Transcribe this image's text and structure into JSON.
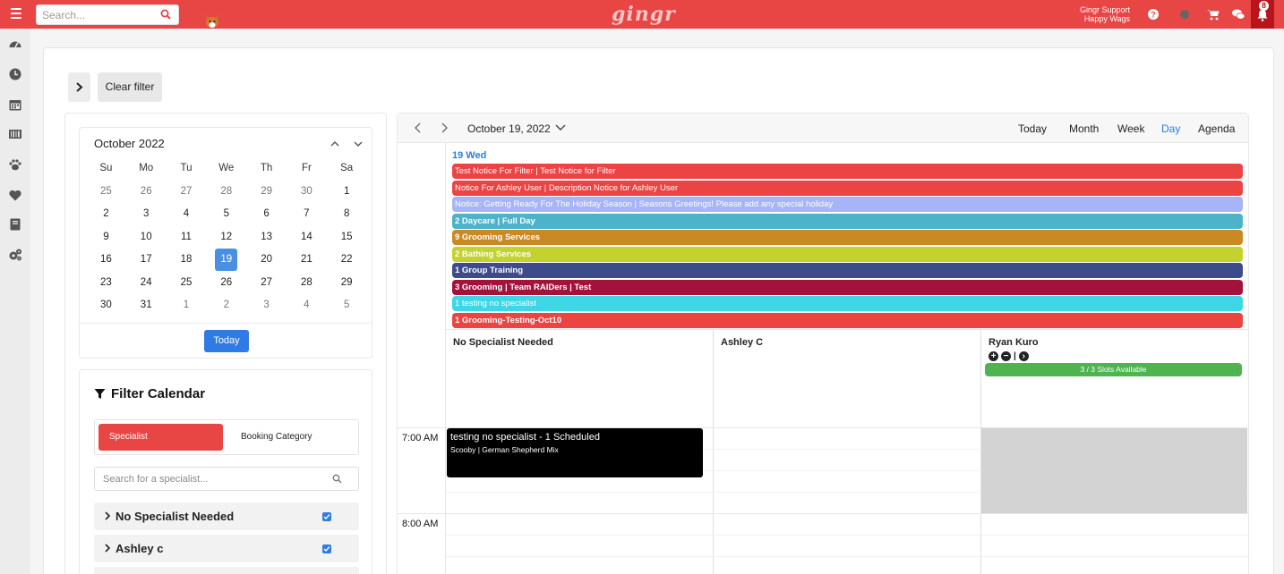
{
  "topbar": {
    "search_placeholder": "Search...",
    "brand": "gingr",
    "user_name": "Gingr Support",
    "business_name": "Happy Wags",
    "notification_count": "8",
    "colors": {
      "bar": "#e84545",
      "bell_bg": "#b7151b"
    }
  },
  "toolbar": {
    "clear_filter": "Clear filter"
  },
  "mini_calendar": {
    "title": "October 2022",
    "weekdays": [
      "Su",
      "Mo",
      "Tu",
      "We",
      "Th",
      "Fr",
      "Sa"
    ],
    "weeks": [
      [
        "25",
        "26",
        "27",
        "28",
        "29",
        "30",
        "1"
      ],
      [
        "2",
        "3",
        "4",
        "5",
        "6",
        "7",
        "8"
      ],
      [
        "9",
        "10",
        "11",
        "12",
        "13",
        "14",
        "15"
      ],
      [
        "16",
        "17",
        "18",
        "19",
        "20",
        "21",
        "22"
      ],
      [
        "23",
        "24",
        "25",
        "26",
        "27",
        "28",
        "29"
      ],
      [
        "30",
        "31",
        "1",
        "2",
        "3",
        "4",
        "5"
      ]
    ],
    "selected": "19",
    "today_button": "Today"
  },
  "filter": {
    "title": "Filter Calendar",
    "tab_specialist": "Specialist",
    "tab_booking_category": "Booking Category",
    "search_placeholder": "Search for a specialist...",
    "specialists": [
      "No Specialist Needed",
      "Ashley c"
    ]
  },
  "calendar": {
    "date_label": "October 19, 2022",
    "views": [
      "Today",
      "Month",
      "Week",
      "Day",
      "Agenda"
    ],
    "active_view": "Day",
    "day_header": "19 Wed",
    "all_day_events": [
      {
        "label": "Test Notice For Filter | Test Notice for Filter",
        "color": "#ec4343",
        "bold": false
      },
      {
        "label": "Notice For Ashley User | Description Notice for Ashley User",
        "color": "#ec4343",
        "bold": false
      },
      {
        "label": "Notice: Getting Ready For The Holiday Season | Seasons Greetings! Please add any special holiday",
        "color": "#a7b4f7",
        "bold": false
      },
      {
        "label": "2 Daycare | Full Day",
        "color": "#4cb3cb",
        "bold": true
      },
      {
        "label": "9 Grooming Services",
        "color": "#c98a23",
        "bold": true
      },
      {
        "label": "2 Bathing Services",
        "color": "#c4d22d",
        "bold": true
      },
      {
        "label": "1 Group Training",
        "color": "#3d4b8a",
        "bold": true
      },
      {
        "label": "3 Grooming | Team RAIDers | Test",
        "color": "#a3123a",
        "bold": true
      },
      {
        "label": "1 testing no specialist",
        "color": "#3fd7e6",
        "bold": false
      },
      {
        "label": "1 Grooming-Testing-Oct10",
        "color": "#ec4343",
        "bold": true
      }
    ],
    "resources": [
      "No Specialist Needed",
      "Ashley C",
      "Ryan Kuro"
    ],
    "ryan_controls": "|",
    "slots_label": "3 / 3 Slots Available",
    "time_labels": [
      "7:00 AM",
      "8:00 AM"
    ],
    "appointment": {
      "title": "testing no specialist - 1 Scheduled",
      "subtitle": "Scooby | German Shepherd Mix"
    }
  }
}
